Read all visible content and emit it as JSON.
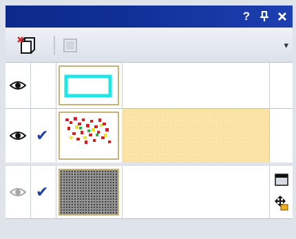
{
  "titlebar": {
    "help_label": "?",
    "pin_label": "∩",
    "close_label": "✖",
    "help_glyph": "?",
    "pin_glyph": "☩",
    "close_glyph": "✕"
  },
  "toolbar": {
    "new_layer_icon": "new-layer-icon",
    "disabled_icon": "layer-options-icon",
    "menu_glyph": "▾"
  },
  "layers": [
    {
      "visible": true,
      "checked": false,
      "thumb": "cyan-rectangle",
      "selected": false
    },
    {
      "visible": true,
      "checked": true,
      "thumb": "colored-dots",
      "selected": true
    },
    {
      "visible": false,
      "checked": true,
      "thumb": "gray-noise",
      "selected": false
    }
  ],
  "check_glyph": "✔",
  "colors": {
    "title_bar": "#102f96",
    "selection": "#fbe4a6",
    "check": "#1c3fa8",
    "cyan": "#1ee6e6"
  }
}
